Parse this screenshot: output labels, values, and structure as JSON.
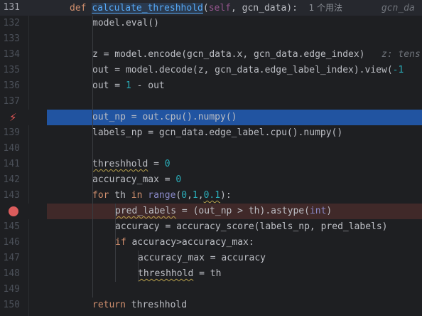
{
  "editor": {
    "line_numbers": [
      "131",
      "132",
      "133",
      "134",
      "135",
      "136",
      "137",
      "138",
      "139",
      "140",
      "141",
      "142",
      "143",
      "144",
      "145",
      "146",
      "147",
      "148",
      "149",
      "150"
    ],
    "usage_hint": "1 个用法",
    "param_hint": "gcn_da",
    "type_hint": "z: tens"
  },
  "tokens": {
    "l131": [
      "def",
      "calculate_threshhold",
      "(",
      "self",
      ", gcn_data):"
    ],
    "l132": [
      "model.eval()"
    ],
    "l134": [
      "z = model.encode(gcn_data.x, gcn_data.edge_index)"
    ],
    "l135": [
      "out = model.decode(z, gcn_data.edge_label_index).view(",
      "-1"
    ],
    "l136": [
      "out = ",
      "1",
      " - out"
    ],
    "l138": [
      "out_np = out.cpu().numpy()"
    ],
    "l139": [
      "labels_np = gcn_data.edge_label.cpu().numpy()"
    ],
    "l141": [
      "threshhold",
      " = ",
      "0"
    ],
    "l142": [
      "accuracy_max",
      " = ",
      "0"
    ],
    "l143": [
      "for",
      " th ",
      "in",
      " ",
      "range",
      "(",
      "0",
      ",",
      "1",
      ",",
      "0.1",
      "):"
    ],
    "l144": [
      "pred_labels",
      " = (out_np > th).astype(",
      "int",
      ")"
    ],
    "l145": [
      "accuracy = accuracy_score(labels_np, pred_labels)"
    ],
    "l146": [
      "if",
      " accuracy>accuracy_max:"
    ],
    "l147": [
      "accuracy_max = accuracy"
    ],
    "l148": [
      "threshhold",
      " = th"
    ],
    "l150": [
      "return",
      " threshhold"
    ]
  }
}
